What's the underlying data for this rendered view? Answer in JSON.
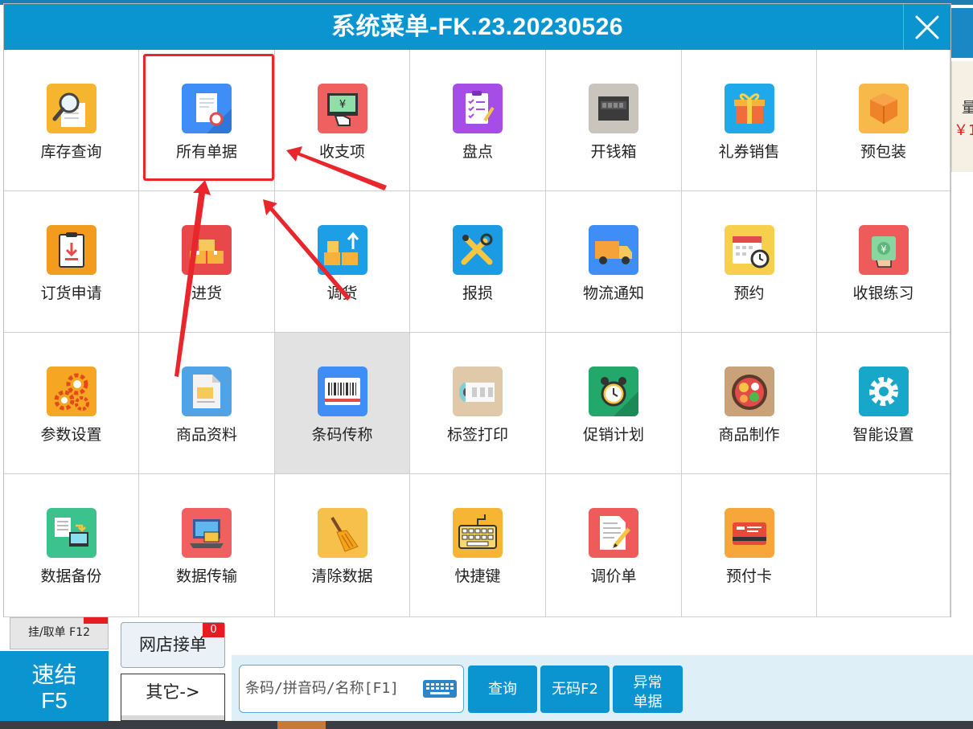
{
  "dialog": {
    "title": "系统菜单-FK.23.20230526",
    "close_icon": "close-icon"
  },
  "menu": [
    {
      "label": "库存查询",
      "icon": "inventory-search-icon",
      "color": "#f5b52e"
    },
    {
      "label": "所有单据",
      "icon": "document-icon",
      "color": "#3f8ef7"
    },
    {
      "label": "收支项",
      "icon": "cash-register-icon",
      "color": "#f06060"
    },
    {
      "label": "盘点",
      "icon": "clipboard-check-icon",
      "color": "#a64de8"
    },
    {
      "label": "开钱箱",
      "icon": "cash-drawer-icon",
      "color": "#c9c4bc"
    },
    {
      "label": "礼券销售",
      "icon": "gift-icon",
      "color": "#1fa9ea"
    },
    {
      "label": "预包装",
      "icon": "package-icon",
      "color": "#f7b94a"
    },
    {
      "label": "订货申请",
      "icon": "order-request-icon",
      "color": "#f29b1f"
    },
    {
      "label": "进货",
      "icon": "stock-in-icon",
      "color": "#e8484a"
    },
    {
      "label": "调货",
      "icon": "transfer-icon",
      "color": "#1c9fe6"
    },
    {
      "label": "报损",
      "icon": "tools-icon",
      "color": "#1a9be4"
    },
    {
      "label": "物流通知",
      "icon": "truck-icon",
      "color": "#3f8ef7"
    },
    {
      "label": "预约",
      "icon": "calendar-clock-icon",
      "color": "#f6d04a"
    },
    {
      "label": "收银练习",
      "icon": "cash-practice-icon",
      "color": "#ef5a5a"
    },
    {
      "label": "参数设置",
      "icon": "gears-icon",
      "color": "#f5a623"
    },
    {
      "label": "商品资料",
      "icon": "product-info-icon",
      "color": "#4fa3e6"
    },
    {
      "label": "条码传称",
      "icon": "barcode-scale-icon",
      "color": "#3f8ef7"
    },
    {
      "label": "标签打印",
      "icon": "label-roll-icon",
      "color": "#e0c9a8"
    },
    {
      "label": "促销计划",
      "icon": "alarm-clock-icon",
      "color": "#23a86b"
    },
    {
      "label": "商品制作",
      "icon": "food-bowl-icon",
      "color": "#c9a27a"
    },
    {
      "label": "智能设置",
      "icon": "settings-gear-icon",
      "color": "#17a7c9"
    },
    {
      "label": "数据备份",
      "icon": "data-backup-icon",
      "color": "#3cc28c"
    },
    {
      "label": "数据传输",
      "icon": "data-transfer-icon",
      "color": "#f06060"
    },
    {
      "label": "清除数据",
      "icon": "broom-icon",
      "color": "#f6c04a"
    },
    {
      "label": "快捷键",
      "icon": "keyboard-icon",
      "color": "#f6b634"
    },
    {
      "label": "调价单",
      "icon": "price-adjust-icon",
      "color": "#ef5a5a"
    },
    {
      "label": "预付卡",
      "icon": "prepaid-card-icon",
      "color": "#f7a63a"
    }
  ],
  "bottom": {
    "suspend_label": "挂/取单 F12",
    "quick_line1": "速结",
    "quick_line2": "F5",
    "online_label": "网店接单",
    "online_badge": "0",
    "other_label": "其它->",
    "search_placeholder": "条码/拼音码/名称[F1]",
    "query_label": "查询",
    "nocode_label": "无码F2",
    "abnormal_line1": "异常",
    "abnormal_line2": "单据"
  },
  "background": {
    "right_card_text1": "量",
    "right_card_text2": "￥1"
  }
}
